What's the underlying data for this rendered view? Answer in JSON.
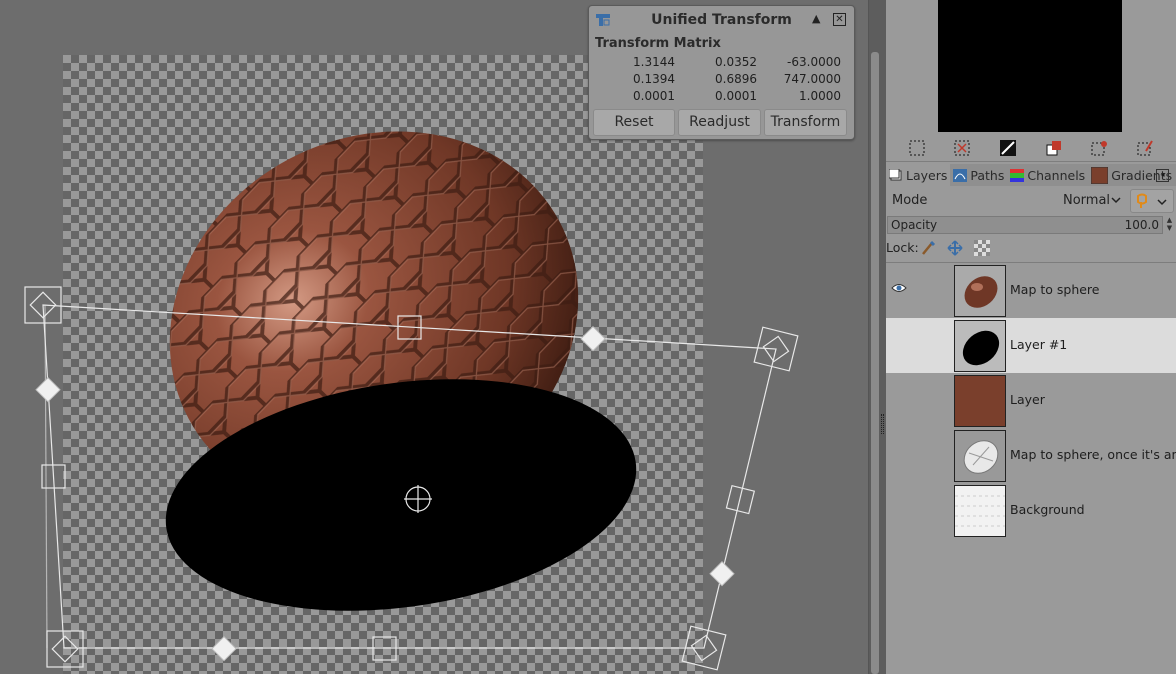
{
  "dialog": {
    "title": "Unified Transform",
    "matrix_heading": "Transform Matrix",
    "matrix": [
      [
        "1.3144",
        "0.0352",
        "-63.0000"
      ],
      [
        "0.1394",
        "0.6896",
        "747.0000"
      ],
      [
        "0.0001",
        "0.0001",
        "1.0000"
      ]
    ],
    "buttons": {
      "reset": "Reset",
      "readjust": "Readjust",
      "transform": "Transform"
    },
    "collapse_glyph": "▲",
    "close_glyph": "✕"
  },
  "dock": {
    "tabs": [
      {
        "label": "Layers",
        "icon": "layers-icon",
        "active": true
      },
      {
        "label": "Paths",
        "icon": "paths-icon",
        "active": false
      },
      {
        "label": "Channels",
        "icon": "channels-icon",
        "active": false
      },
      {
        "label": "Gradients",
        "icon": "gradients-icon",
        "active": false
      }
    ],
    "mode_label": "Mode",
    "mode_value": "Normal",
    "opacity_label": "Opacity",
    "opacity_value": "100.0",
    "opacity_fraction": 1.0,
    "lock_label": "Lock:",
    "layers": [
      {
        "name": "Map to sphere",
        "visible": true,
        "selected": false,
        "thumb": "egg"
      },
      {
        "name": "Layer #1",
        "visible": false,
        "selected": true,
        "thumb": "black-ellipse"
      },
      {
        "name": "Layer",
        "visible": false,
        "selected": false,
        "thumb": "brown-fill"
      },
      {
        "name": "Map to sphere, once it's an egg",
        "visible": false,
        "selected": false,
        "thumb": "white-egg"
      },
      {
        "name": "Background",
        "visible": false,
        "selected": false,
        "thumb": "white-pattern"
      }
    ]
  },
  "colors": {
    "egg_brown": "#7a3f2c",
    "accent_orange": "#e08a1a",
    "selected_row": "#dcdcdc"
  }
}
